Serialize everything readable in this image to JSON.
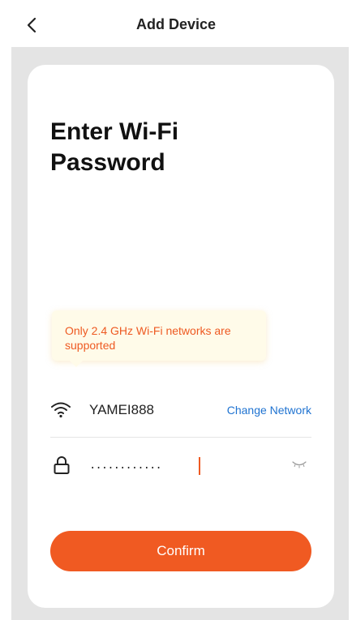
{
  "header": {
    "title": "Add Device",
    "back_icon": "chevron-left-icon"
  },
  "main": {
    "title": "Enter Wi-Fi Password",
    "tip": "Only 2.4 GHz Wi-Fi networks are supported",
    "wifi": {
      "icon": "wifi-icon",
      "ssid": "YAMEI888",
      "change_label": "Change Network"
    },
    "password": {
      "icon": "lock-icon",
      "value": "............",
      "visibility_icon": "eye-closed-icon"
    },
    "confirm_label": "Confirm"
  },
  "colors": {
    "accent": "#f05a22",
    "link": "#1f73d1",
    "tip_bg": "#fffbe9",
    "tip_text": "#ee5a22",
    "page_bg": "#e4e4e4"
  }
}
